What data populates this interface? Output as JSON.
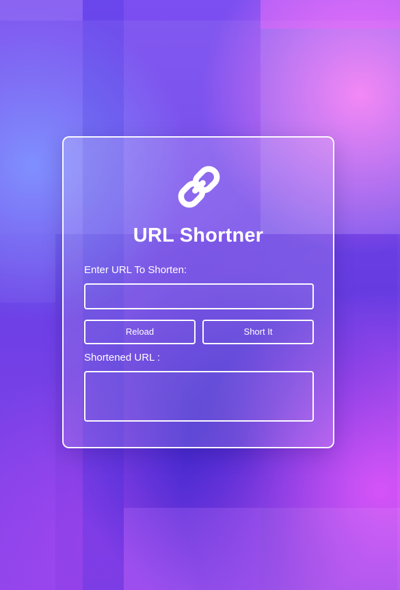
{
  "app": {
    "title": "URL Shortner"
  },
  "icons": {
    "main": "link-icon"
  },
  "form": {
    "url_label": "Enter URL To Shorten:",
    "url_value": "",
    "url_placeholder": "",
    "shortened_label": "Shortened URL :",
    "shortened_value": "",
    "shortened_placeholder": ""
  },
  "actions": {
    "reload_label": "Reload",
    "short_label": "Short It"
  },
  "colors": {
    "text": "#ffffff",
    "accent": "#ffffff"
  }
}
